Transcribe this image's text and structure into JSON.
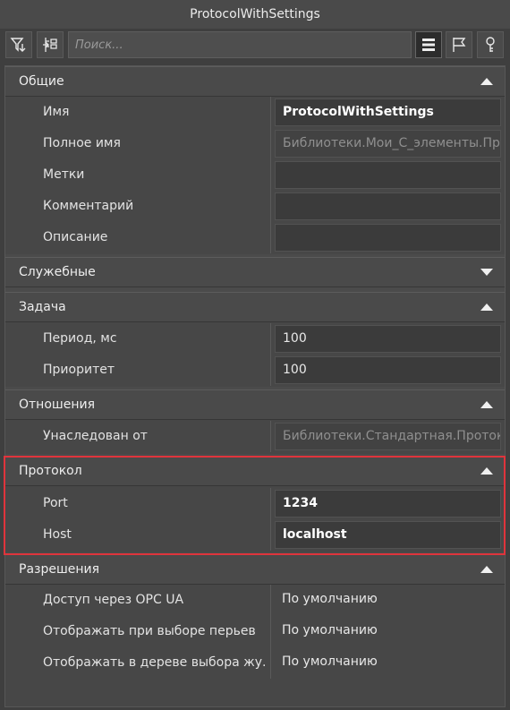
{
  "window": {
    "title": "ProtocolWithSettings"
  },
  "toolbar": {
    "filter_icon": "filter-icon",
    "collapse_icon": "collapse-tree-icon",
    "search_placeholder": "Поиск...",
    "list_icon": "list-view-icon",
    "flag_icon": "flag-icon",
    "key_icon": "key-icon"
  },
  "sections": {
    "general": {
      "title": "Общие",
      "rows": [
        {
          "label": "Имя",
          "value": "ProtocolWithSettings"
        },
        {
          "label": "Полное имя",
          "value": "Библиотеки.Мои_С_элементы.Про"
        },
        {
          "label": "Метки",
          "value": ""
        },
        {
          "label": "Комментарий",
          "value": ""
        },
        {
          "label": "Описание",
          "value": ""
        }
      ]
    },
    "service": {
      "title": "Служебные"
    },
    "task": {
      "title": "Задача",
      "rows": [
        {
          "label": "Период, мс",
          "value": "100"
        },
        {
          "label": "Приоритет",
          "value": "100"
        }
      ]
    },
    "relations": {
      "title": "Отношения",
      "rows": [
        {
          "label": "Унаследован от",
          "value": "Библиотеки.Стандартная.Протоко."
        }
      ]
    },
    "protocol": {
      "title": "Протокол",
      "rows": [
        {
          "label": "Port",
          "value": "1234"
        },
        {
          "label": "Host",
          "value": "localhost"
        }
      ]
    },
    "permissions": {
      "title": "Разрешения",
      "rows": [
        {
          "label": "Доступ через OPC UA",
          "value": "По умолчанию"
        },
        {
          "label": "Отображать при выборе перьев",
          "value": "По умолчанию"
        },
        {
          "label": "Отображать в дереве выбора жу...",
          "value": "По умолчанию"
        }
      ]
    }
  },
  "colors": {
    "highlight": "#e0343c",
    "background": "#3f3f3f"
  }
}
